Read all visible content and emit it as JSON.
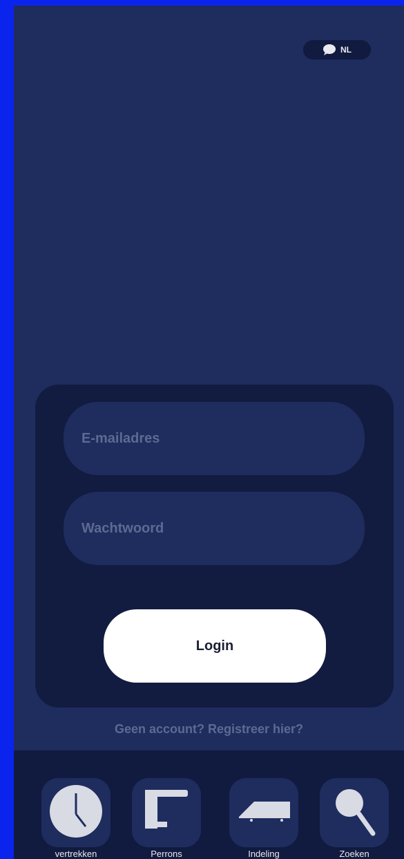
{
  "language": {
    "code": "NL",
    "icon": "speech-bubble-icon"
  },
  "login": {
    "email_placeholder": "E-mailadres",
    "password_placeholder": "Wachtwoord",
    "login_label": "Login"
  },
  "register_text": "Geen account? Registreer hier?",
  "nav": {
    "items": [
      {
        "label": "vertrekken",
        "icon": "clock-icon"
      },
      {
        "label": "Perrons",
        "icon": "platform-icon"
      },
      {
        "label": "Indeling",
        "icon": "train-icon"
      },
      {
        "label": "Zoeken",
        "icon": "search-icon"
      }
    ]
  },
  "colors": {
    "background": "#1f2c5e",
    "card": "#121b40",
    "button": "#ffffff",
    "icon": "#d8dbe3"
  }
}
